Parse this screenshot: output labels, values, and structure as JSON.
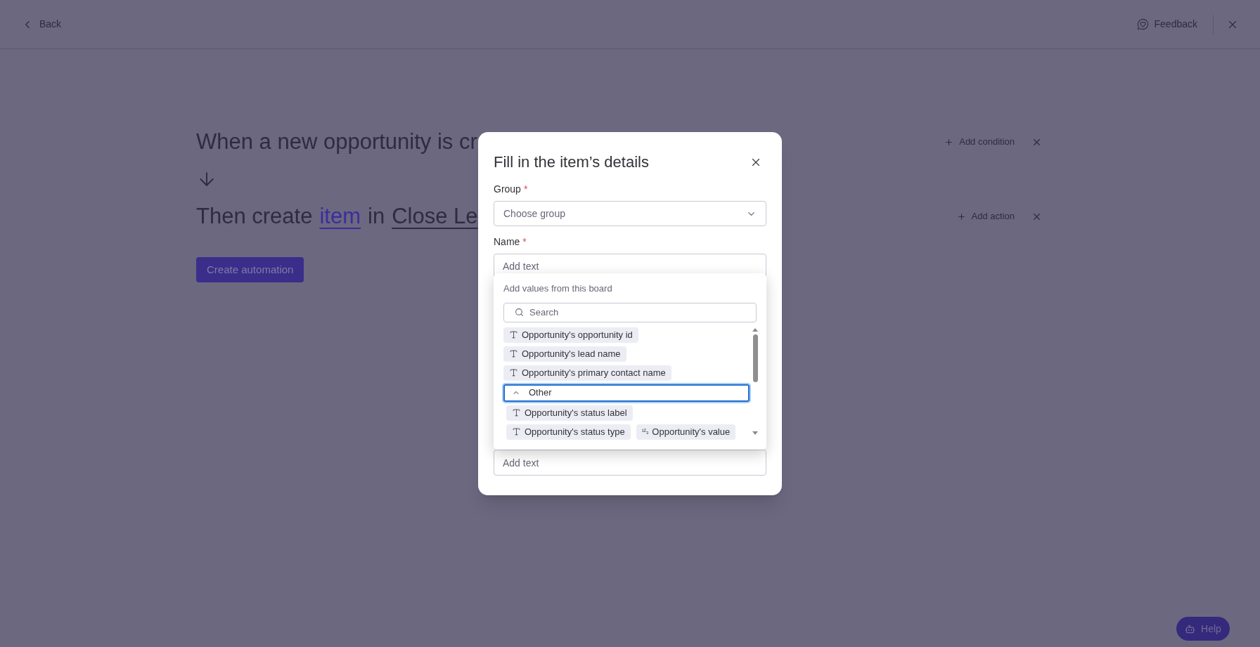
{
  "topbar": {
    "back": "Back",
    "feedback": "Feedback"
  },
  "trigger": {
    "text": "When a new opportunity is cr",
    "action_label": "Add condition"
  },
  "action": {
    "parts": [
      {
        "text": "Then create",
        "kind": "plain"
      },
      {
        "text": "item",
        "kind": "link"
      },
      {
        "text": "in",
        "kind": "plain"
      },
      {
        "text": "Close Le",
        "kind": "field"
      }
    ],
    "action_label": "Add action"
  },
  "create_button": "Create automation",
  "help_button": "Help",
  "modal": {
    "title": "Fill in the item’s details",
    "fields": [
      {
        "label": "Group",
        "required_mark": "*",
        "kind": "select",
        "placeholder": "Choose group"
      },
      {
        "label": "Name",
        "required_mark": "*",
        "kind": "text",
        "placeholder": "Add text"
      }
    ],
    "popup": {
      "title": "Add values from this board",
      "search_placeholder": "Search",
      "groups": [
        {
          "rows": [
            [
              {
                "kind": "text",
                "label": "Opportunity's opportunity id"
              }
            ],
            [
              {
                "kind": "text",
                "label": "Opportunity's lead name"
              }
            ],
            [
              {
                "kind": "text",
                "label": "Opportunity's primary contact name"
              }
            ]
          ]
        },
        {
          "label": "Other",
          "expanded": true,
          "focused": true,
          "rows": [
            [
              {
                "kind": "text",
                "label": "Opportunity's status label"
              }
            ],
            [
              {
                "kind": "text",
                "label": "Opportunity's status type"
              },
              {
                "kind": "number",
                "glyph": "¹²₃",
                "label": "Opportunity's value"
              }
            ]
          ]
        }
      ]
    },
    "lower_field": {
      "placeholder": "Add text"
    }
  }
}
